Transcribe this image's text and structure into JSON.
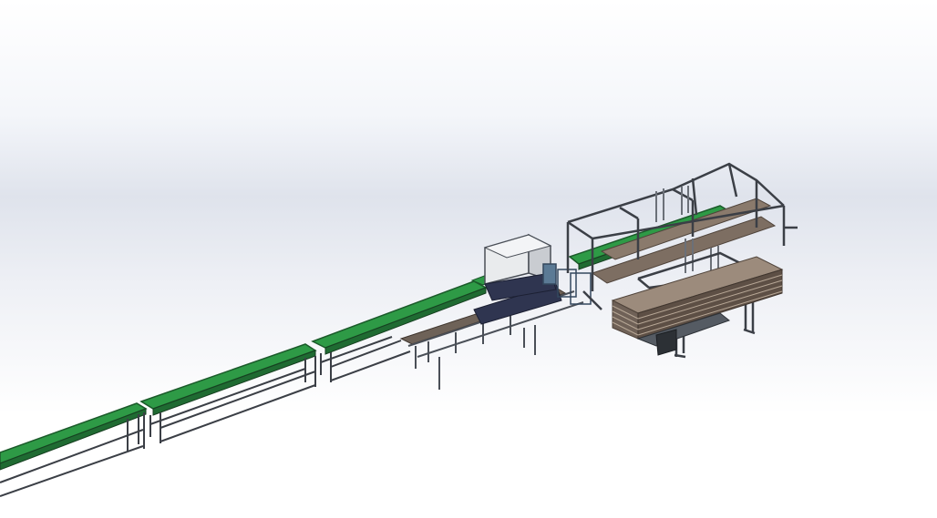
{
  "viewport": {
    "label": "",
    "colors": {
      "conveyor_belt": "#2e9a46",
      "conveyor_belt_edge": "#1b5a2a",
      "frame_steel": "#3b3f46",
      "frame_light": "#9aa0a8",
      "machine_housing": "#e6e8ea",
      "machine_dark": "#2f3550",
      "wood_stack": "#8a7a6c",
      "wood_dark": "#5d4f45",
      "background_top": "#ffffff",
      "background_band": "#dfe3ec"
    }
  },
  "model": {
    "components": [
      "belt-conveyor-section-1",
      "belt-conveyor-section-2",
      "belt-conveyor-section-3",
      "belt-conveyor-section-4",
      "cutting-machine",
      "roller-transfer-table",
      "gantry-stacker",
      "lumber-stack"
    ]
  }
}
